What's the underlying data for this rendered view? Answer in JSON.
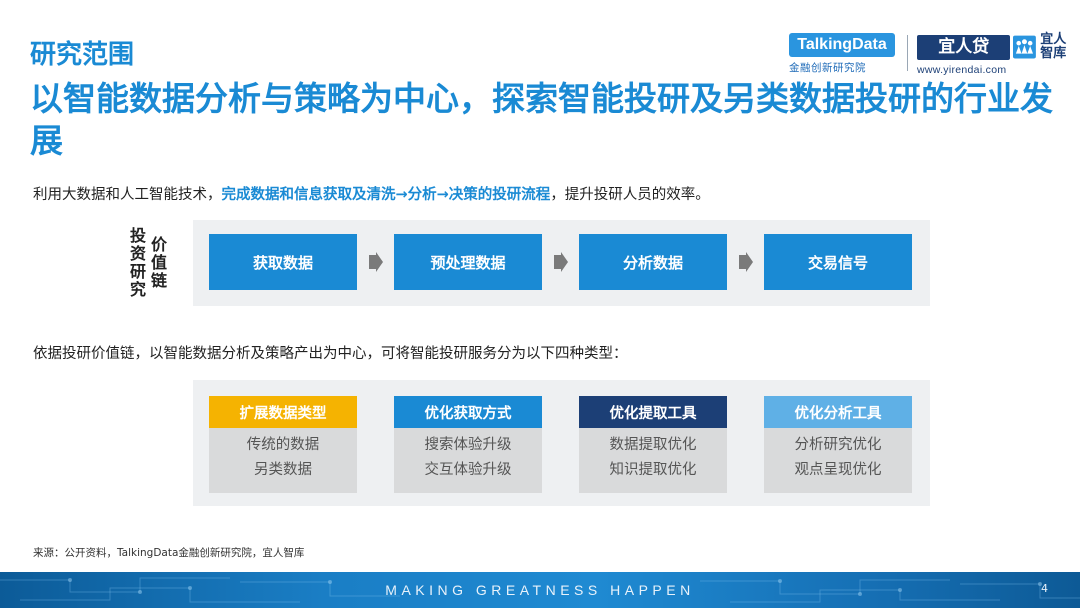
{
  "header": {
    "section_title": "研究范围",
    "headline": "以智能数据分析与策略为中心，探索智能投研及另类数据投研的行业发展"
  },
  "brands": {
    "talkingdata": {
      "name": "TalkingData",
      "sub": "金融创新研究院"
    },
    "yirendai": {
      "name": "宜人贷",
      "zk": "宜人智库",
      "url": "www.yirendai.com"
    }
  },
  "intro": {
    "prefix": "利用大数据和人工智能技术，",
    "highlight": "完成数据和信息获取及清洗→分析→决策的投研流程",
    "suffix": "，提升投研人员的效率。"
  },
  "value_chain": {
    "label_a": "投资研究",
    "label_b": "价值链",
    "steps": [
      "获取数据",
      "预处理数据",
      "分析数据",
      "交易信号"
    ]
  },
  "types_intro": "依据投研价值链，以智能数据分析及策略产出为中心，可将智能投研服务分为以下四种类型：",
  "service_types": [
    {
      "title": "扩展数据类型",
      "items": [
        "传统的数据",
        "另类数据"
      ]
    },
    {
      "title": "优化获取方式",
      "items": [
        "搜索体验升级",
        "交互体验升级"
      ]
    },
    {
      "title": "优化提取工具",
      "items": [
        "数据提取优化",
        "知识提取优化"
      ]
    },
    {
      "title": "优化分析工具",
      "items": [
        "分析研究优化",
        "观点呈现优化"
      ]
    }
  ],
  "colors": {
    "primary": "#1a8ad4",
    "type_heads": [
      "#f5b301",
      "#1a8ad4",
      "#1c3f76",
      "#5fb0e6"
    ]
  },
  "source": "来源：公开资料，TalkingData金融创新研究院，宜人智库",
  "footer": {
    "slogan": "MAKING GREATNESS HAPPEN",
    "page_number": "4"
  }
}
